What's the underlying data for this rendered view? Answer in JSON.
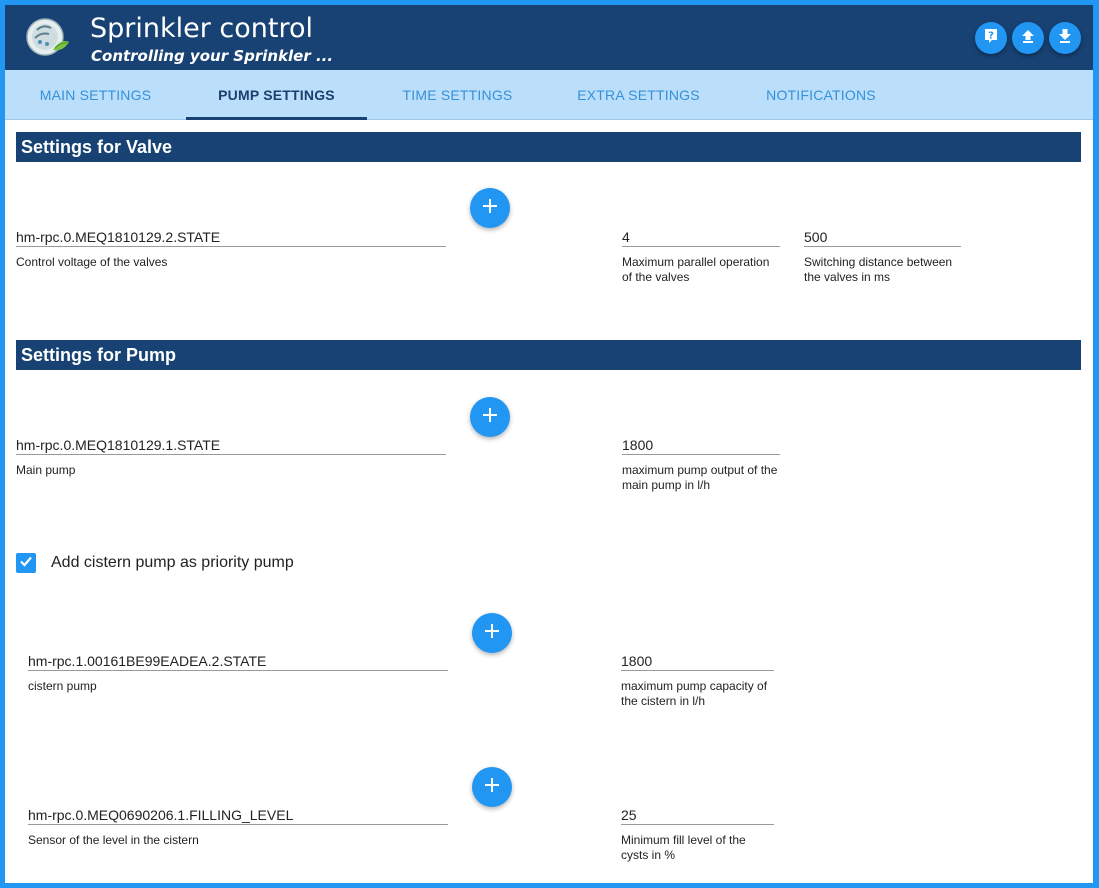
{
  "header": {
    "title": "Sprinkler control",
    "subtitle": "Controlling your Sprinkler ...",
    "buttons": [
      {
        "icon": "help-icon"
      },
      {
        "icon": "upload-icon"
      },
      {
        "icon": "download-icon"
      }
    ]
  },
  "tabs": [
    {
      "label": "MAIN SETTINGS"
    },
    {
      "label": "PUMP SETTINGS",
      "active": true
    },
    {
      "label": "TIME SETTINGS"
    },
    {
      "label": "EXTRA SETTINGS"
    },
    {
      "label": "NOTIFICATIONS"
    }
  ],
  "valve": {
    "title": "Settings for Valve",
    "control_state": {
      "value": "hm-rpc.0.MEQ1810129.2.STATE",
      "label": "Control voltage of the valves"
    },
    "max_parallel": {
      "value": "4",
      "label": "Maximum parallel operation of the valves"
    },
    "switching_distance": {
      "value": "500",
      "label": "Switching distance between the valves in ms"
    }
  },
  "pump": {
    "title": "Settings for Pump",
    "main_pump": {
      "value": "hm-rpc.0.MEQ1810129.1.STATE",
      "label": "Main pump"
    },
    "main_pump_output": {
      "value": "1800",
      "label": "maximum pump output of the main pump in l/h"
    },
    "cistern_checkbox": {
      "label": "Add cistern pump as priority pump",
      "checked": true
    },
    "cistern_pump": {
      "value": "hm-rpc.1.00161BE99EADEA.2.STATE",
      "label": "cistern pump"
    },
    "cistern_capacity": {
      "value": "1800",
      "label": "maximum pump capacity of the cistern in l/h"
    },
    "level_sensor": {
      "value": "hm-rpc.0.MEQ0690206.1.FILLING_LEVEL",
      "label": "Sensor of the level in the cistern"
    },
    "min_fill_level": {
      "value": "25",
      "label": "Minimum fill level of the cysts in %"
    }
  },
  "colors": {
    "header_bg": "#174273",
    "tab_bar_bg": "#bbdefb",
    "accent": "#2196f3",
    "tab_inactive": "#3591d8"
  }
}
